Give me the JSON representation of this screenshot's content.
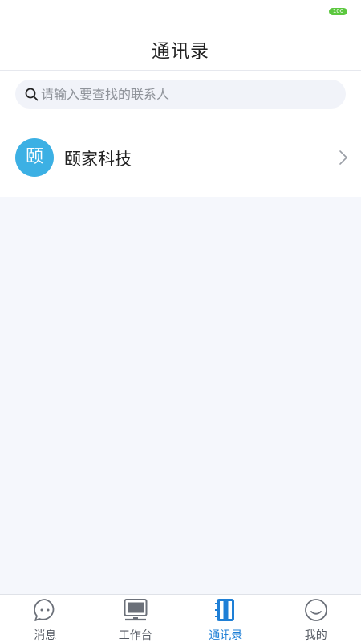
{
  "status_bar": {
    "battery_level": "100"
  },
  "header": {
    "title": "通讯录"
  },
  "search": {
    "placeholder": "请输入要查找的联系人"
  },
  "contacts": [
    {
      "avatar_text": "颐",
      "name": "颐家科技",
      "avatar_color": "#3cb0e4"
    }
  ],
  "tabs": [
    {
      "label": "消息",
      "icon": "chat-bubble-icon",
      "active": false
    },
    {
      "label": "工作台",
      "icon": "monitor-icon",
      "active": false
    },
    {
      "label": "通讯录",
      "icon": "address-book-icon",
      "active": true
    },
    {
      "label": "我的",
      "icon": "smile-icon",
      "active": false
    }
  ],
  "colors": {
    "accent": "#1e7fd6",
    "avatar": "#3cb0e4",
    "battery": "#5cc83f",
    "background": "#f5f7fc"
  }
}
